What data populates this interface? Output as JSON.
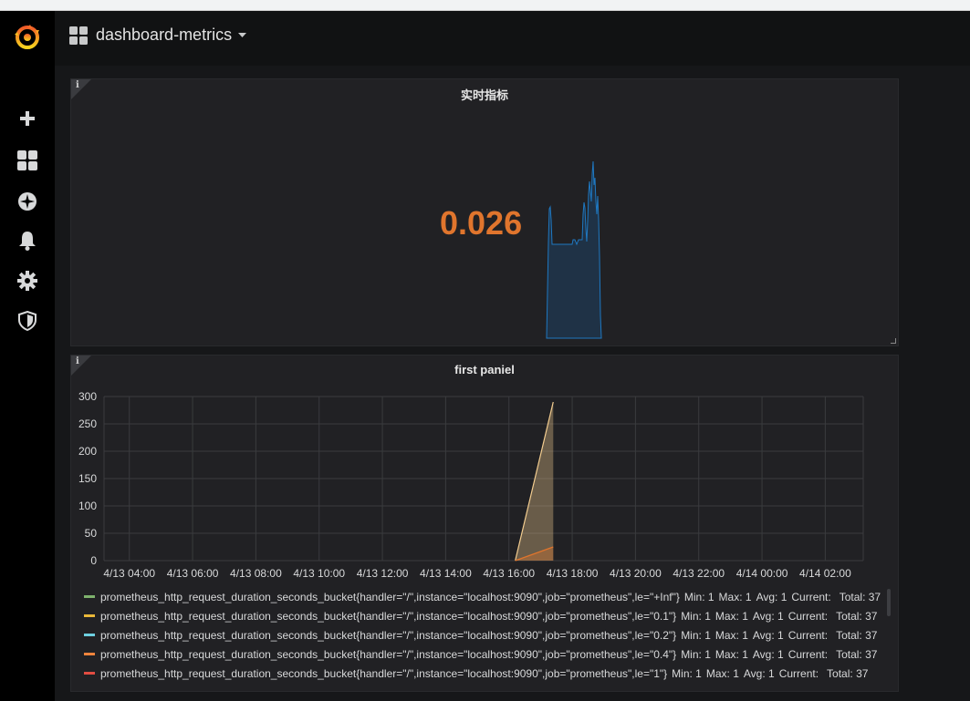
{
  "dashboard": {
    "title": "dashboard-metrics"
  },
  "sidebar": {
    "items": [
      {
        "name": "grafana-logo-icon"
      },
      {
        "name": "plus-icon"
      },
      {
        "name": "dashboards-icon"
      },
      {
        "name": "explore-icon"
      },
      {
        "name": "alert-bell-icon"
      },
      {
        "name": "gear-icon"
      },
      {
        "name": "shield-icon"
      }
    ]
  },
  "panels": {
    "stat": {
      "title": "实时指标",
      "info_glyph": "i",
      "value": "0.026",
      "value_color": "#e0752d"
    },
    "graph": {
      "title": "first paniel",
      "info_glyph": "i"
    }
  },
  "chart_data": {
    "type": "line",
    "y_ticks": [
      "300",
      "250",
      "200",
      "150",
      "100",
      "50",
      "0"
    ],
    "ylim": [
      0,
      300
    ],
    "x_ticks": [
      "4/13 04:00",
      "4/13 06:00",
      "4/13 08:00",
      "4/13 10:00",
      "4/13 12:00",
      "4/13 14:00",
      "4/13 16:00",
      "4/13 18:00",
      "4/13 20:00",
      "4/13 22:00",
      "4/14 00:00",
      "4/14 02:00"
    ],
    "grid": true,
    "series": [
      {
        "points": [
          [
            16.2,
            0
          ],
          [
            17.4,
            290
          ]
        ],
        "color": "#f2cc8f"
      },
      {
        "points": [
          [
            16.2,
            0
          ],
          [
            17.4,
            25
          ]
        ],
        "color": "#e0752d"
      }
    ],
    "legend": [
      {
        "color": "#7eb26d",
        "label": "prometheus_http_request_duration_seconds_bucket{handler=\"/\",instance=\"localhost:9090\",job=\"prometheus\",le=\"+Inf\"}",
        "min": "Min: 1",
        "max": "Max: 1",
        "avg": "Avg: 1",
        "current": "Current:",
        "total": "Total: 37"
      },
      {
        "color": "#eab839",
        "label": "prometheus_http_request_duration_seconds_bucket{handler=\"/\",instance=\"localhost:9090\",job=\"prometheus\",le=\"0.1\"}",
        "min": "Min: 1",
        "max": "Max: 1",
        "avg": "Avg: 1",
        "current": "Current:",
        "total": "Total: 37"
      },
      {
        "color": "#6ed0e0",
        "label": "prometheus_http_request_duration_seconds_bucket{handler=\"/\",instance=\"localhost:9090\",job=\"prometheus\",le=\"0.2\"}",
        "min": "Min: 1",
        "max": "Max: 1",
        "avg": "Avg: 1",
        "current": "Current:",
        "total": "Total: 37"
      },
      {
        "color": "#ef843c",
        "label": "prometheus_http_request_duration_seconds_bucket{handler=\"/\",instance=\"localhost:9090\",job=\"prometheus\",le=\"0.4\"}",
        "min": "Min: 1",
        "max": "Max: 1",
        "avg": "Avg: 1",
        "current": "Current:",
        "total": "Total: 37"
      },
      {
        "color": "#e24d42",
        "label": "prometheus_http_request_duration_seconds_bucket{handler=\"/\",instance=\"localhost:9090\",job=\"prometheus\",le=\"1\"}",
        "min": "Min: 1",
        "max": "Max: 1",
        "avg": "Avg: 1",
        "current": "Current:",
        "total": "Total: 37"
      }
    ]
  }
}
